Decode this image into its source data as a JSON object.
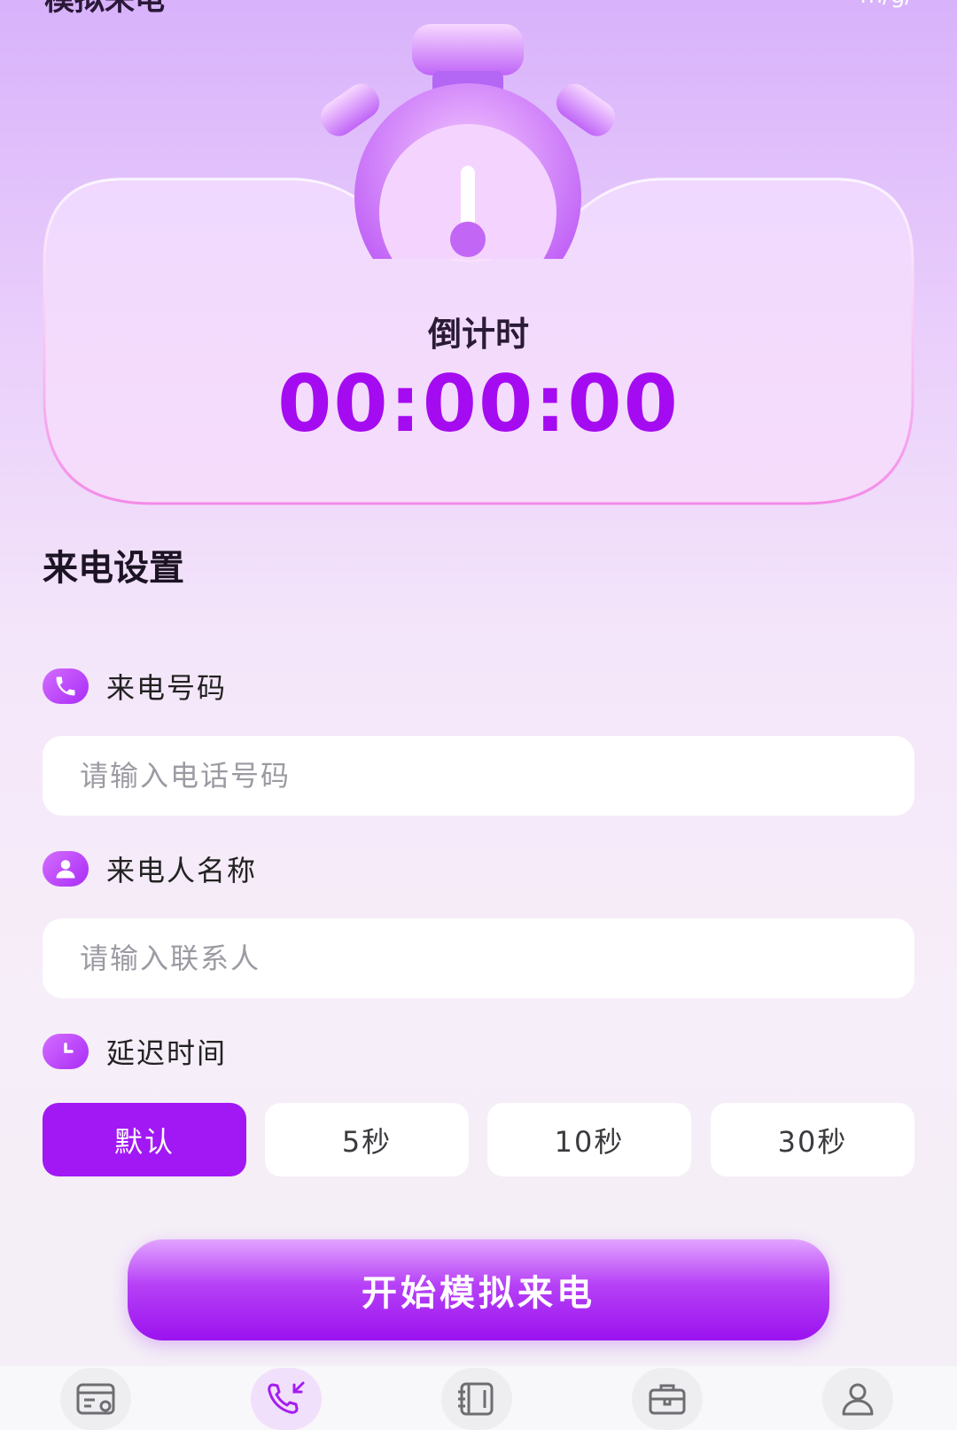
{
  "header": {
    "title": "模拟来电",
    "right": "m/g/"
  },
  "countdown": {
    "label": "倒计时",
    "time": "00:00:00"
  },
  "settings": {
    "title": "来电设置",
    "phone": {
      "label": "来电号码",
      "placeholder": "请输入电话号码",
      "icon": "phone-icon"
    },
    "name": {
      "label": "来电人名称",
      "placeholder": "请输入联系人",
      "icon": "user-icon"
    },
    "delay": {
      "label": "延迟时间",
      "icon": "clock-icon",
      "options": [
        "默认",
        "5秒",
        "10秒",
        "30秒"
      ],
      "selected": "默认"
    }
  },
  "start_button": "开始模拟来电",
  "tabbar": {
    "items": [
      {
        "icon": "bill-icon",
        "active": false
      },
      {
        "icon": "incoming-call-icon",
        "active": true
      },
      {
        "icon": "notebook-icon",
        "active": false
      },
      {
        "icon": "briefcase-icon",
        "active": false
      },
      {
        "icon": "profile-icon",
        "active": false
      }
    ]
  },
  "colors": {
    "accent": "#a50bf0",
    "button": "#a118f4",
    "background": "#f4e6fa"
  }
}
